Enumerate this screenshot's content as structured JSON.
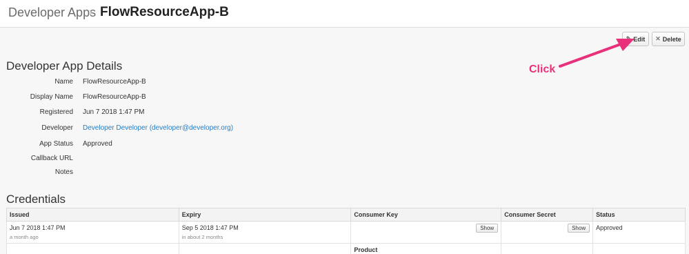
{
  "breadcrumb": {
    "parent": "Developer Apps",
    "separator": "›",
    "current": "FlowResourceApp-B"
  },
  "toolbar": {
    "edit_label": "Edit",
    "edit_icon": "pencil-icon",
    "delete_label": "Delete",
    "delete_icon": "close-icon"
  },
  "annotation": {
    "label": "Click",
    "color": "#e8317a"
  },
  "details": {
    "title": "Developer App Details",
    "fields": [
      {
        "label": "Name",
        "value": "FlowResourceApp-B"
      },
      {
        "label": "Display Name",
        "value": "FlowResourceApp-B"
      },
      {
        "label": "Registered",
        "value": "Jun 7 2018 1:47 PM"
      },
      {
        "label": "Developer",
        "value": "Developer Developer (developer@developer.org)"
      },
      {
        "label": "App Status",
        "value": "Approved"
      },
      {
        "label": "Callback URL",
        "value": ""
      },
      {
        "label": "Notes",
        "value": ""
      }
    ]
  },
  "credentials": {
    "title": "Credentials",
    "columns": [
      "Issued",
      "Expiry",
      "Consumer Key",
      "Consumer Secret",
      "Status"
    ],
    "rows": [
      {
        "issued": "Jun 7 2018 1:47 PM",
        "issued_relative": "a month ago",
        "expiry": "Sep 5 2018 1:47 PM",
        "expiry_relative": "in about 2 months",
        "key_button": "Show",
        "secret_button": "Show",
        "status": "Approved"
      }
    ],
    "product_header": "Product"
  },
  "colors": {
    "link": "#2a7bbf",
    "accent": "#e8317a"
  }
}
